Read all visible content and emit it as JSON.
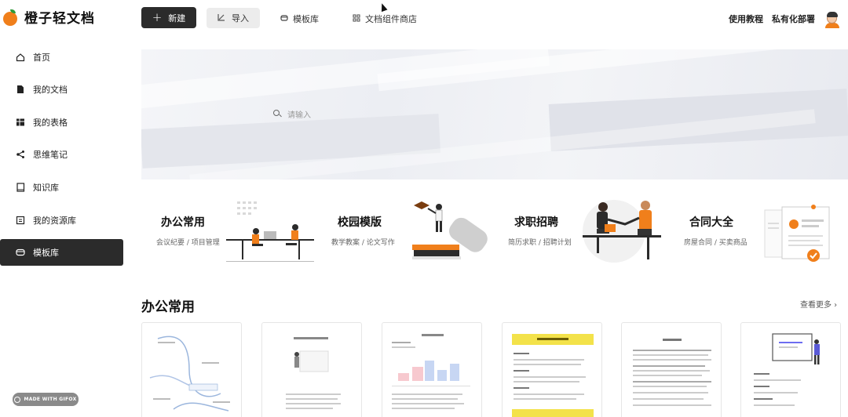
{
  "app": {
    "name": "橙子轻文档"
  },
  "toolbar": {
    "new_label": "新建",
    "import_label": "导入",
    "templates_label": "模板库",
    "shop_label": "文档组件商店",
    "tutorial_label": "使用教程",
    "private_label": "私有化部署"
  },
  "sidebar": {
    "items": [
      {
        "label": "首页",
        "icon": "home-icon"
      },
      {
        "label": "我的文档",
        "icon": "document-icon"
      },
      {
        "label": "我的表格",
        "icon": "table-icon"
      },
      {
        "label": "思维笔记",
        "icon": "mindmap-icon"
      },
      {
        "label": "知识库",
        "icon": "book-icon"
      },
      {
        "label": "我的资源库",
        "icon": "folder-icon"
      },
      {
        "label": "模板库",
        "icon": "template-icon",
        "active": true
      }
    ]
  },
  "hero": {
    "search_placeholder": "请输入"
  },
  "categories": [
    {
      "title": "办公常用",
      "subtitle": "会议纪要 / 项目管理"
    },
    {
      "title": "校园模版",
      "subtitle": "教学教案 / 论文写作"
    },
    {
      "title": "求职招聘",
      "subtitle": "简历求职 / 招聘计划"
    },
    {
      "title": "合同大全",
      "subtitle": "房屋合同 / 买卖商品"
    }
  ],
  "section": {
    "title": "办公常用",
    "more_label": "查看更多 ›"
  },
  "badge": {
    "label": "MADE WITH GIFOX"
  },
  "colors": {
    "accent": "#f07f1b",
    "dark": "#2b2b2b"
  }
}
